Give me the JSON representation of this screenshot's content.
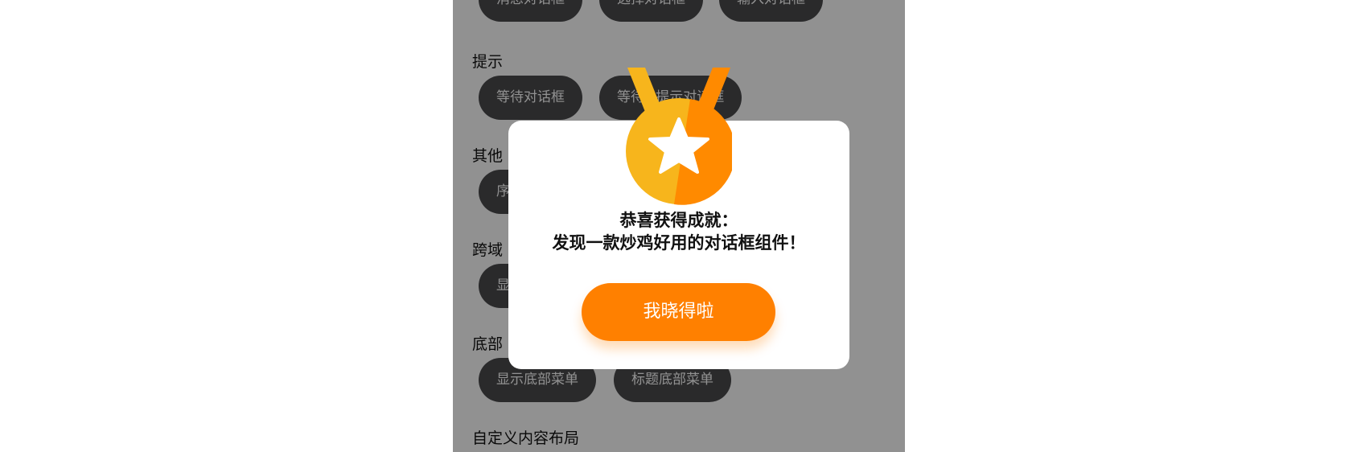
{
  "app": {
    "row_top_buttons": [
      "消息对话框",
      "选择对话框",
      "输入对话框"
    ],
    "sections": {
      "tip": {
        "title": "提示",
        "buttons": [
          "等待对话框",
          "等待+提示对话框"
        ]
      },
      "other": {
        "title": "其他",
        "button_fragment": "序"
      },
      "cross": {
        "title": "跨域",
        "button_fragment": "显"
      },
      "bottom": {
        "title": "底部",
        "buttons": [
          "显示底部菜单",
          "标题底部菜单"
        ]
      },
      "custom": {
        "title": "自定义内容布局"
      }
    }
  },
  "dialog": {
    "medal_icon": "medal-icon",
    "line1": "恭喜获得成就：",
    "line2": "发现一款炒鸡好用的对话框组件！",
    "button_label": "我晓得啦",
    "colors": {
      "accent": "#ff8000",
      "medal_gold": "#f7b51c",
      "medal_orange": "#ff8a00",
      "overlay": "#8e8e90"
    }
  }
}
